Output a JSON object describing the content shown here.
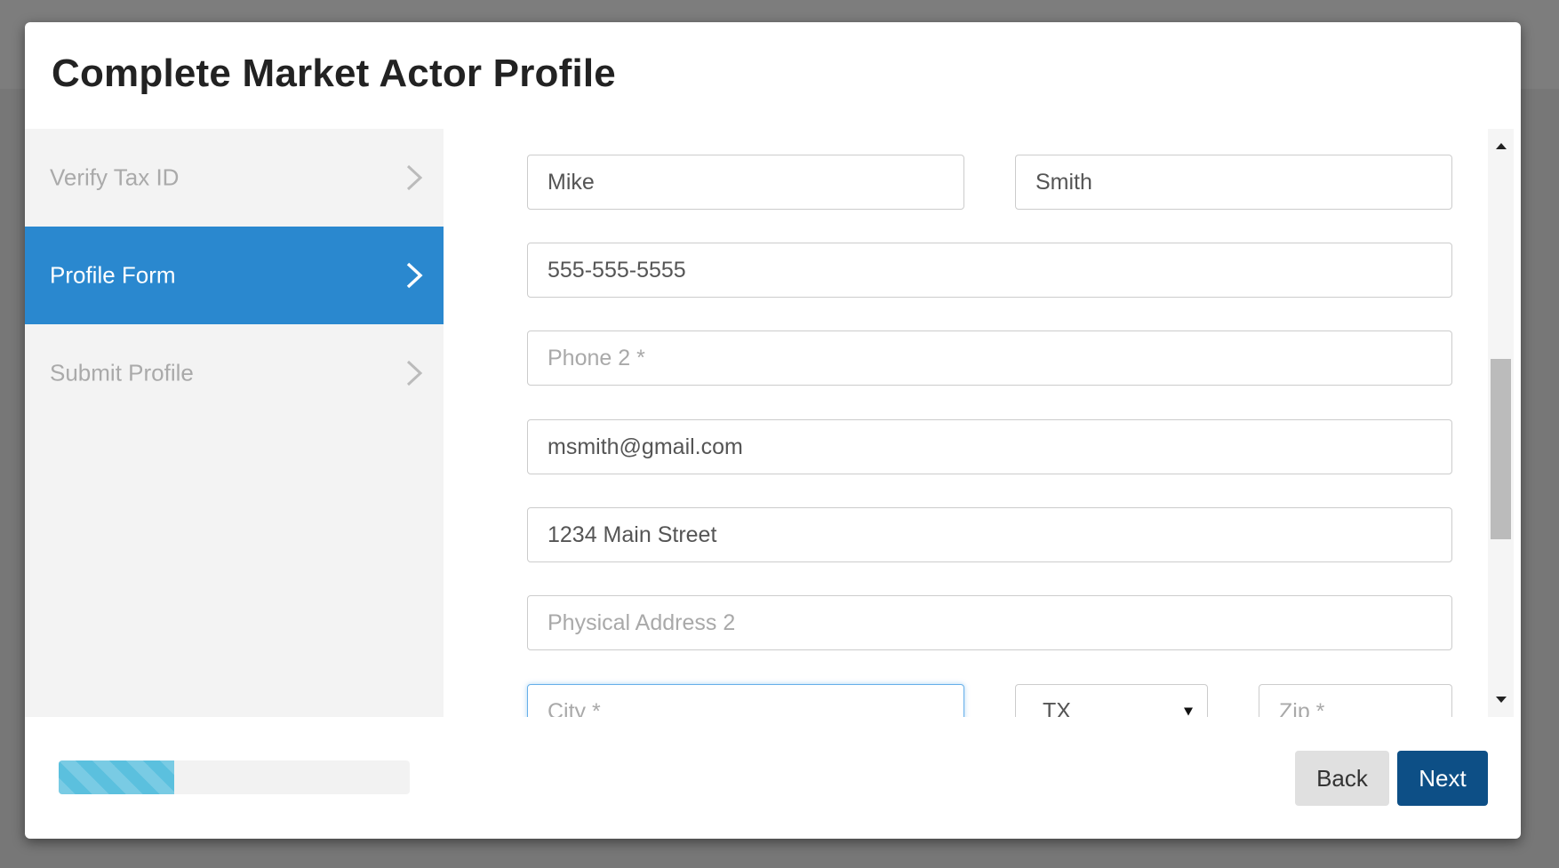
{
  "dialog": {
    "title": "Complete Market Actor Profile"
  },
  "steps": [
    {
      "label": "Verify Tax ID",
      "state": "inactive"
    },
    {
      "label": "Profile Form",
      "state": "active"
    },
    {
      "label": "Submit Profile",
      "state": "inactive"
    }
  ],
  "form": {
    "first_name": {
      "value": "Mike",
      "placeholder": ""
    },
    "last_name": {
      "value": "Smith",
      "placeholder": ""
    },
    "phone1": {
      "value": "555-555-5555",
      "placeholder": ""
    },
    "phone2": {
      "value": "",
      "placeholder": "Phone 2 *"
    },
    "email": {
      "value": "msmith@gmail.com",
      "placeholder": ""
    },
    "address1": {
      "value": "1234 Main Street",
      "placeholder": ""
    },
    "address2": {
      "value": "",
      "placeholder": "Physical Address 2"
    },
    "city": {
      "value": "",
      "placeholder": "City *"
    },
    "state": {
      "value": "TX"
    },
    "zip": {
      "value": "",
      "placeholder": "Zip *"
    }
  },
  "progress": {
    "fraction": 0.33
  },
  "buttons": {
    "back": "Back",
    "next": "Next"
  },
  "colors": {
    "active_step": "#2a88cf",
    "next_button": "#0d4f86",
    "progress": "#5bc0de"
  }
}
